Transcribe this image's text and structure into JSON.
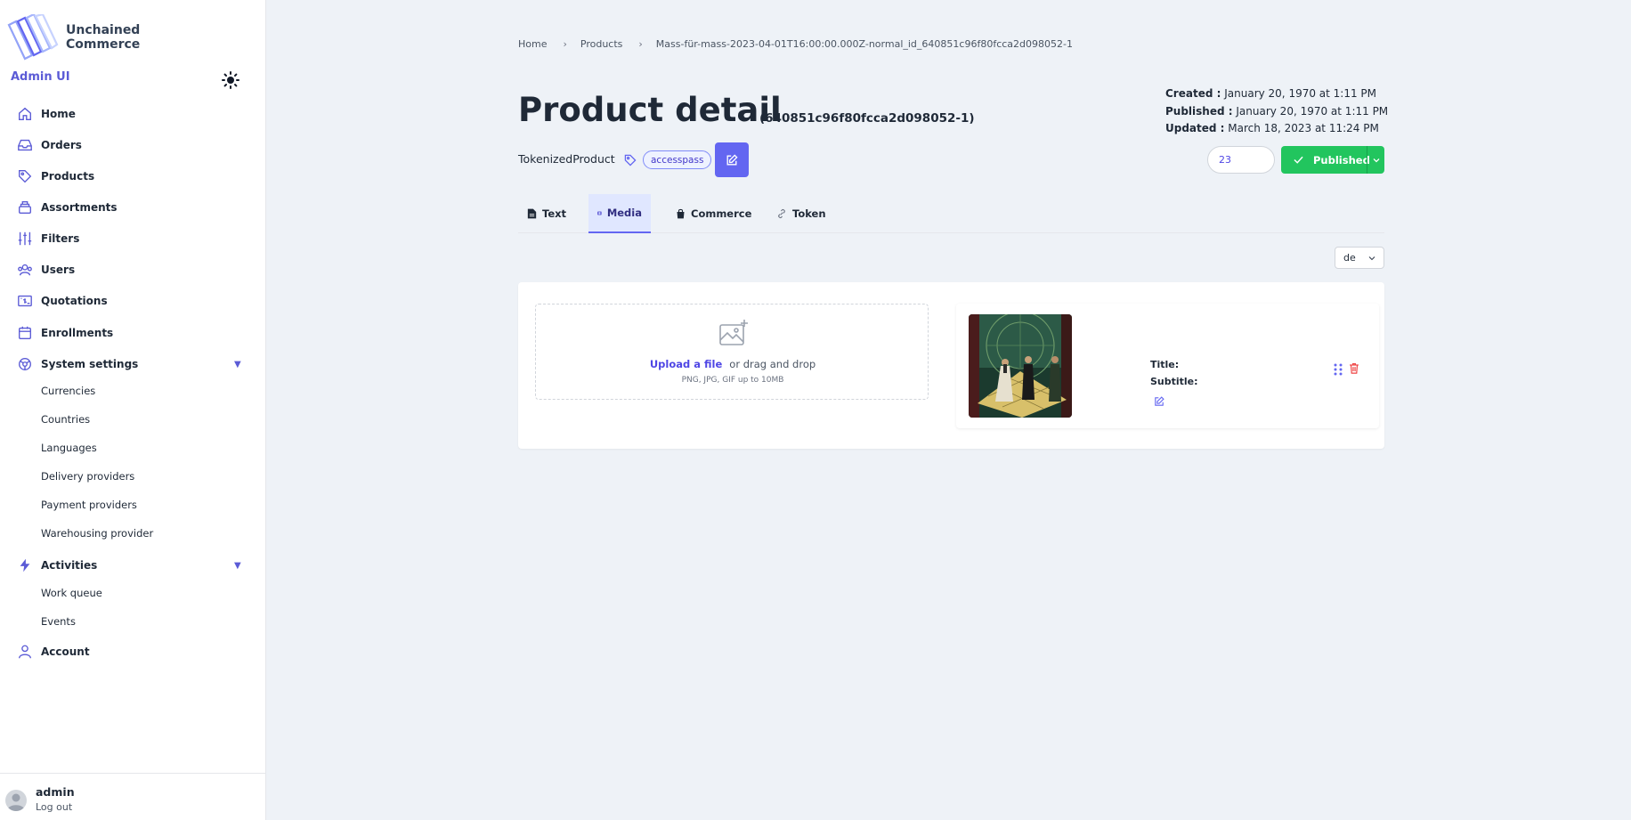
{
  "brand": {
    "name_line1": "Unchained",
    "name_line2": "Commerce",
    "subtitle": "Admin UI"
  },
  "nav": {
    "items": [
      {
        "label": "Home",
        "icon": "home-icon"
      },
      {
        "label": "Orders",
        "icon": "inbox-icon"
      },
      {
        "label": "Products",
        "icon": "tag-icon"
      },
      {
        "label": "Assortments",
        "icon": "stack-icon"
      },
      {
        "label": "Filters",
        "icon": "sliders-icon"
      },
      {
        "label": "Users",
        "icon": "users-icon"
      },
      {
        "label": "Quotations",
        "icon": "receipt-icon"
      },
      {
        "label": "Enrollments",
        "icon": "calendar-icon"
      },
      {
        "label": "System settings",
        "icon": "cog-icon"
      },
      {
        "label": "Activities",
        "icon": "bolt-icon"
      },
      {
        "label": "Account",
        "icon": "user-icon"
      }
    ],
    "system_settings_sub": [
      "Currencies",
      "Countries",
      "Languages",
      "Delivery providers",
      "Payment providers",
      "Warehousing provider"
    ],
    "activities_sub": [
      "Work queue",
      "Events"
    ]
  },
  "user": {
    "name": "admin",
    "logout": "Log out"
  },
  "breadcrumb": [
    "Home",
    "Products",
    "Mass-für-mass-2023-04-01T16:00:00.000Z-normal_id_640851c96f80fcca2d098052-1"
  ],
  "header": {
    "title": "Product detail",
    "id": "(640851c96f80fcca2d098052-1)",
    "product_type": "TokenizedProduct",
    "tag": "accesspass",
    "created_label": "Created :",
    "created_value": "January 20, 1970 at 1:11 PM",
    "published_label": "Published :",
    "published_value": "January 20, 1970 at 1:11 PM",
    "updated_label": "Updated :",
    "updated_value": "March 18, 2023 at 11:24 PM",
    "sequence": "23",
    "status": "Published"
  },
  "tabs": [
    {
      "label": "Text",
      "icon": "document-icon"
    },
    {
      "label": "Media",
      "icon": "film-icon",
      "active": true
    },
    {
      "label": "Commerce",
      "icon": "bag-icon"
    },
    {
      "label": "Token",
      "icon": "link-icon"
    }
  ],
  "locale": {
    "selected": "de"
  },
  "upload": {
    "link": "Upload a file",
    "text": "or drag and drop",
    "hint": "PNG, JPG, GIF up to 10MB"
  },
  "media_item": {
    "title_label": "Title:",
    "subtitle_label": "Subtitle:"
  },
  "colors": {
    "accent": "#6366f1",
    "published": "#22c55e",
    "danger": "#ef4444",
    "background": "#eef2f7"
  }
}
